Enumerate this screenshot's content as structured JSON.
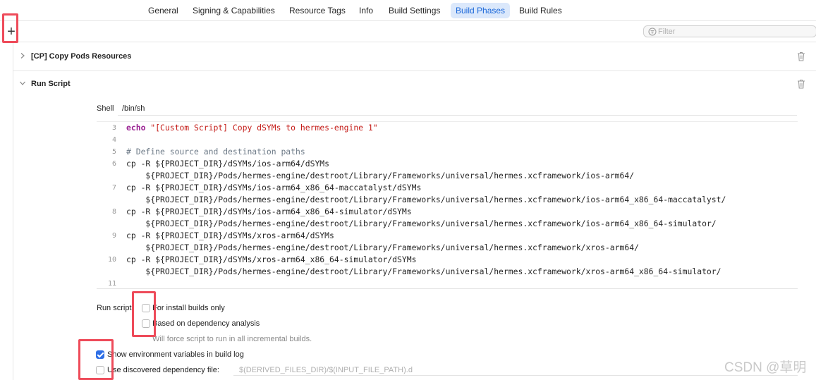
{
  "tabs": [
    {
      "label": "General",
      "active": false
    },
    {
      "label": "Signing & Capabilities",
      "active": false
    },
    {
      "label": "Resource Tags",
      "active": false
    },
    {
      "label": "Info",
      "active": false
    },
    {
      "label": "Build Settings",
      "active": false
    },
    {
      "label": "Build Phases",
      "active": true
    },
    {
      "label": "Build Rules",
      "active": false
    }
  ],
  "toolbar": {
    "add_label": "+",
    "filter_placeholder": "Filter"
  },
  "phases": [
    {
      "title": "[CP] Copy Pods Resources",
      "expanded": false
    },
    {
      "title": "Run Script",
      "expanded": true
    }
  ],
  "shell": {
    "label": "Shell",
    "value": "/bin/sh"
  },
  "code_lines": [
    {
      "n": "3",
      "text": "echo \"[Custom Script] Copy dSYMs to hermes-engine 1\""
    },
    {
      "n": "4",
      "text": ""
    },
    {
      "n": "5",
      "text": "# Define source and destination paths"
    },
    {
      "n": "6",
      "text": "cp -R ${PROJECT_DIR}/dSYMs/ios-arm64/dSYMs"
    },
    {
      "n": "",
      "text": "    ${PROJECT_DIR}/Pods/hermes-engine/destroot/Library/Frameworks/universal/hermes.xcframework/ios-arm64/"
    },
    {
      "n": "7",
      "text": "cp -R ${PROJECT_DIR}/dSYMs/ios-arm64_x86_64-maccatalyst/dSYMs"
    },
    {
      "n": "",
      "text": "    ${PROJECT_DIR}/Pods/hermes-engine/destroot/Library/Frameworks/universal/hermes.xcframework/ios-arm64_x86_64-maccatalyst/"
    },
    {
      "n": "8",
      "text": "cp -R ${PROJECT_DIR}/dSYMs/ios-arm64_x86_64-simulator/dSYMs"
    },
    {
      "n": "",
      "text": "    ${PROJECT_DIR}/Pods/hermes-engine/destroot/Library/Frameworks/universal/hermes.xcframework/ios-arm64_x86_64-simulator/"
    },
    {
      "n": "9",
      "text": "cp -R ${PROJECT_DIR}/dSYMs/xros-arm64/dSYMs"
    },
    {
      "n": "",
      "text": "    ${PROJECT_DIR}/Pods/hermes-engine/destroot/Library/Frameworks/universal/hermes.xcframework/xros-arm64/"
    },
    {
      "n": "10",
      "text": "cp -R ${PROJECT_DIR}/dSYMs/xros-arm64_x86_64-simulator/dSYMs"
    },
    {
      "n": "",
      "text": "    ${PROJECT_DIR}/Pods/hermes-engine/destroot/Library/Frameworks/universal/hermes.xcframework/xros-arm64_x86_64-simulator/"
    },
    {
      "n": "",
      "text": ""
    },
    {
      "n": "11",
      "text": ""
    }
  ],
  "options": {
    "run_script_label": "Run script:",
    "install_builds_label": "For install builds only",
    "install_builds_checked": false,
    "dependency_analysis_label": "Based on dependency analysis",
    "dependency_analysis_checked": false,
    "dependency_hint": "Will force script to run in all incremental builds.",
    "show_env_label": "Show environment variables in build log",
    "show_env_checked": true,
    "discovered_dep_label": "Use discovered dependency file:",
    "discovered_dep_checked": false,
    "discovered_dep_placeholder": "$(DERIVED_FILES_DIR)/$(INPUT_FILE_PATH).d"
  },
  "watermark": "CSDN @草明",
  "colors": {
    "accent": "#2e6fe6",
    "active_tab_bg": "#dbe8fb",
    "highlight": "#ee4b5a"
  }
}
